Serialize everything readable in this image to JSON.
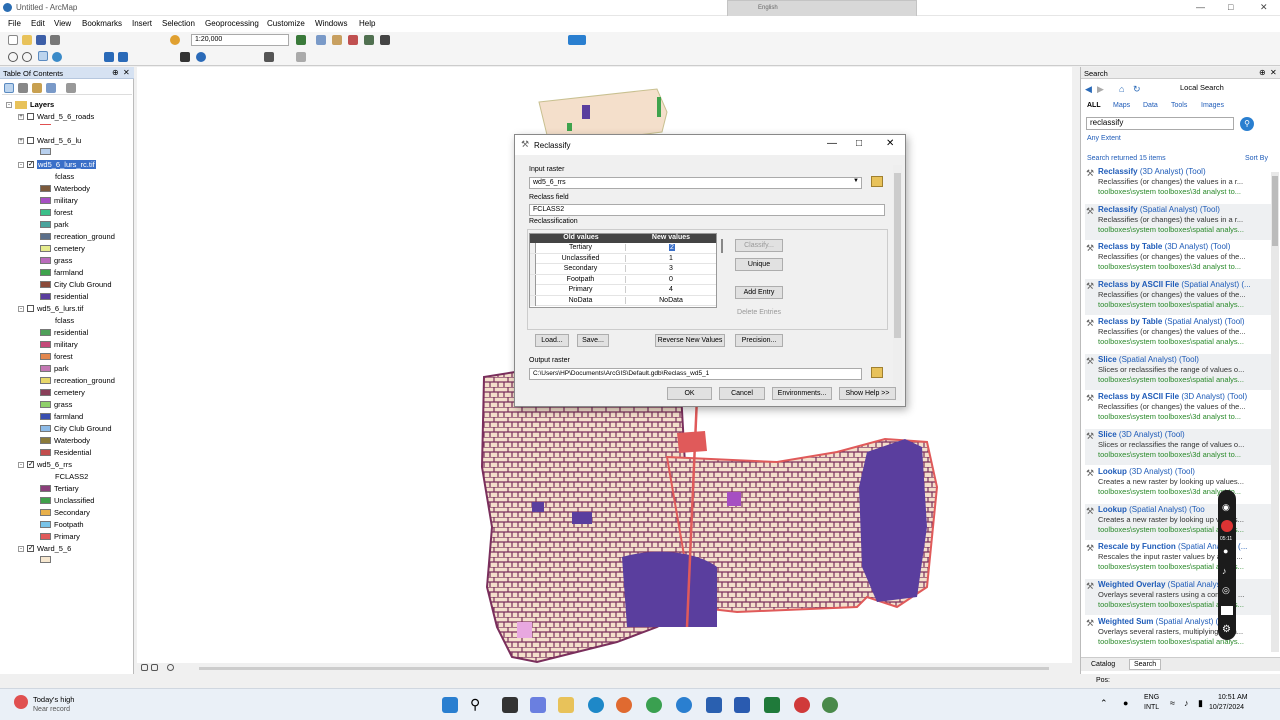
{
  "window": {
    "title": "Untitled - ArcMap"
  },
  "menu": [
    "File",
    "Edit",
    "View",
    "Bookmarks",
    "Insert",
    "Selection",
    "Geoprocessing",
    "Customize",
    "Windows",
    "Help"
  ],
  "toolbar": {
    "scale": "1:20,000"
  },
  "floating_bar": {
    "label": "English"
  },
  "toc": {
    "title": "Table Of Contents",
    "root": "Layers",
    "layers": [
      {
        "name": "Ward_5_6_roads",
        "checked": false,
        "items": []
      },
      {
        "name": "Ward_5_6_lu",
        "checked": false,
        "items": []
      },
      {
        "name": "wd5_6_lurs_rc.tif",
        "checked": true,
        "selected": true,
        "field": "fclass",
        "items": [
          {
            "label": "Waterbody",
            "color": "#7b5a3c"
          },
          {
            "label": "military",
            "color": "#a64fc2"
          },
          {
            "label": "forest",
            "color": "#3cc08a"
          },
          {
            "label": "park",
            "color": "#4aa39c"
          },
          {
            "label": "recreation_ground",
            "color": "#5b6f8a"
          },
          {
            "label": "cemetery",
            "color": "#e6ec8e"
          },
          {
            "label": "grass",
            "color": "#b96bbb"
          },
          {
            "label": "farmland",
            "color": "#3fa34d"
          },
          {
            "label": "City Club Ground",
            "color": "#8a4a3a"
          },
          {
            "label": "residential",
            "color": "#5a3e9e"
          }
        ]
      },
      {
        "name": "wd5_6_lurs.tif",
        "checked": false,
        "field": "fclass",
        "items": [
          {
            "label": "residential",
            "color": "#4fa05a"
          },
          {
            "label": "military",
            "color": "#c54a7a"
          },
          {
            "label": "forest",
            "color": "#e3874e"
          },
          {
            "label": "park",
            "color": "#c478b4"
          },
          {
            "label": "recreation_ground",
            "color": "#e8d86a"
          },
          {
            "label": "cemetery",
            "color": "#8a3f5a"
          },
          {
            "label": "grass",
            "color": "#8fd06a"
          },
          {
            "label": "farmland",
            "color": "#3a4fb0"
          },
          {
            "label": "City Club Ground",
            "color": "#8dbbe8"
          },
          {
            "label": "Waterbody",
            "color": "#8a7a3a"
          },
          {
            "label": "Residential",
            "color": "#c24d4d"
          }
        ]
      },
      {
        "name": "wd5_6_rrs",
        "checked": true,
        "field": "FCLASS2",
        "items": [
          {
            "label": "Tertiary",
            "color": "#8a3f7a"
          },
          {
            "label": "Unclassified",
            "color": "#3fa04a"
          },
          {
            "label": "Secondary",
            "color": "#e8b04a"
          },
          {
            "label": "Footpath",
            "color": "#7ac4e8"
          },
          {
            "label": "Primary",
            "color": "#e05a5a"
          }
        ]
      },
      {
        "name": "Ward_5_6",
        "checked": true,
        "items": [
          {
            "label": "",
            "color": "#f6e7cf"
          }
        ]
      }
    ]
  },
  "dialog": {
    "title": "Reclassify",
    "input_raster_label": "Input raster",
    "input_raster": "wd5_6_rrs",
    "reclass_field_label": "Reclass field",
    "reclass_field": "FCLASS2",
    "reclassification_label": "Reclassification",
    "col_old": "Old values",
    "col_new": "New values",
    "rows": [
      {
        "old": "Tertiary",
        "new": "2"
      },
      {
        "old": "Unclassified",
        "new": "1"
      },
      {
        "old": "Secondary",
        "new": "3"
      },
      {
        "old": "Footpath",
        "new": "0"
      },
      {
        "old": "Primary",
        "new": "4"
      },
      {
        "old": "NoData",
        "new": "NoData"
      }
    ],
    "buttons": {
      "classify": "Classify...",
      "unique": "Unique",
      "add_entry": "Add Entry",
      "delete_entries": "Delete Entries",
      "load": "Load...",
      "save": "Save...",
      "reverse": "Reverse New Values",
      "precision": "Precision...",
      "ok": "OK",
      "cancel": "Cancel",
      "environments": "Environments...",
      "show_help": "Show Help >>"
    },
    "output_raster_label": "Output raster",
    "output_raster": "C:\\Users\\HP\\Documents\\ArcGIS\\Default.gdb\\Reclass_wd5_1"
  },
  "search": {
    "title": "Search",
    "location": "Local Search",
    "tabs": [
      "ALL",
      "Maps",
      "Data",
      "Tools",
      "Images"
    ],
    "query": "reclassify",
    "any_extent": "Any Extent",
    "returned": "Search returned 15 items",
    "sort": "Sort By",
    "results": [
      {
        "name": "Reclassify",
        "tag": "(3D Analyst) (Tool)",
        "desc": "Reclassifies (or changes) the values in a r...",
        "path": "toolboxes\\system toolboxes\\3d analyst to..."
      },
      {
        "name": "Reclassify",
        "tag": "(Spatial Analyst) (Tool)",
        "desc": "Reclassifies (or changes) the values in a r...",
        "path": "toolboxes\\system toolboxes\\spatial analys..."
      },
      {
        "name": "Reclass by Table",
        "tag": "(3D Analyst) (Tool)",
        "desc": "Reclassifies (or changes) the values of the...",
        "path": "toolboxes\\system toolboxes\\3d analyst to..."
      },
      {
        "name": "Reclass by ASCII File",
        "tag": "(Spatial Analyst) (...",
        "desc": "Reclassifies (or changes) the values of the...",
        "path": "toolboxes\\system toolboxes\\spatial analys..."
      },
      {
        "name": "Reclass by Table",
        "tag": "(Spatial Analyst) (Tool)",
        "desc": "Reclassifies (or changes) the values of the...",
        "path": "toolboxes\\system toolboxes\\spatial analys..."
      },
      {
        "name": "Slice",
        "tag": "(Spatial Analyst) (Tool)",
        "desc": "Slices or reclassifies the range of values o...",
        "path": "toolboxes\\system toolboxes\\spatial analys..."
      },
      {
        "name": "Reclass by ASCII File",
        "tag": "(3D Analyst) (Tool)",
        "desc": "Reclassifies (or changes) the values of the...",
        "path": "toolboxes\\system toolboxes\\3d analyst to..."
      },
      {
        "name": "Slice",
        "tag": "(3D Analyst) (Tool)",
        "desc": "Slices or reclassifies the range of values o...",
        "path": "toolboxes\\system toolboxes\\3d analyst to..."
      },
      {
        "name": "Lookup",
        "tag": "(3D Analyst) (Tool)",
        "desc": "Creates a new raster by looking up values...",
        "path": "toolboxes\\system toolboxes\\3d analyst to..."
      },
      {
        "name": "Lookup",
        "tag": "(Spatial Analyst) (Too",
        "desc": "Creates a new raster by looking up values...",
        "path": "toolboxes\\system toolboxes\\spatial analys..."
      },
      {
        "name": "Rescale by Function",
        "tag": "(Spatial Analyst) (...",
        "desc": "Rescales the input raster values by applyi...",
        "path": "toolboxes\\system toolboxes\\spatial analys..."
      },
      {
        "name": "Weighted Overlay",
        "tag": "(Spatial Analyst)",
        "desc": "Overlays several rasters using a common ...",
        "path": "toolboxes\\system toolboxes\\spatial analys..."
      },
      {
        "name": "Weighted Sum",
        "tag": "(Spatial Analyst) (Tool)",
        "desc": "Overlays several rasters, multiplying each...",
        "path": "toolboxes\\system toolboxes\\spatial analys..."
      }
    ],
    "bottom_tabs": [
      "Catalog",
      "Search"
    ],
    "pos_label": "Pos:"
  },
  "recorder": {
    "time": "05:11"
  },
  "taskbar": {
    "weather_title": "Today's high",
    "weather_sub": "Near record",
    "lang1": "ENG",
    "lang2": "INTL",
    "time": "10:51 AM",
    "date": "10/27/2024"
  }
}
